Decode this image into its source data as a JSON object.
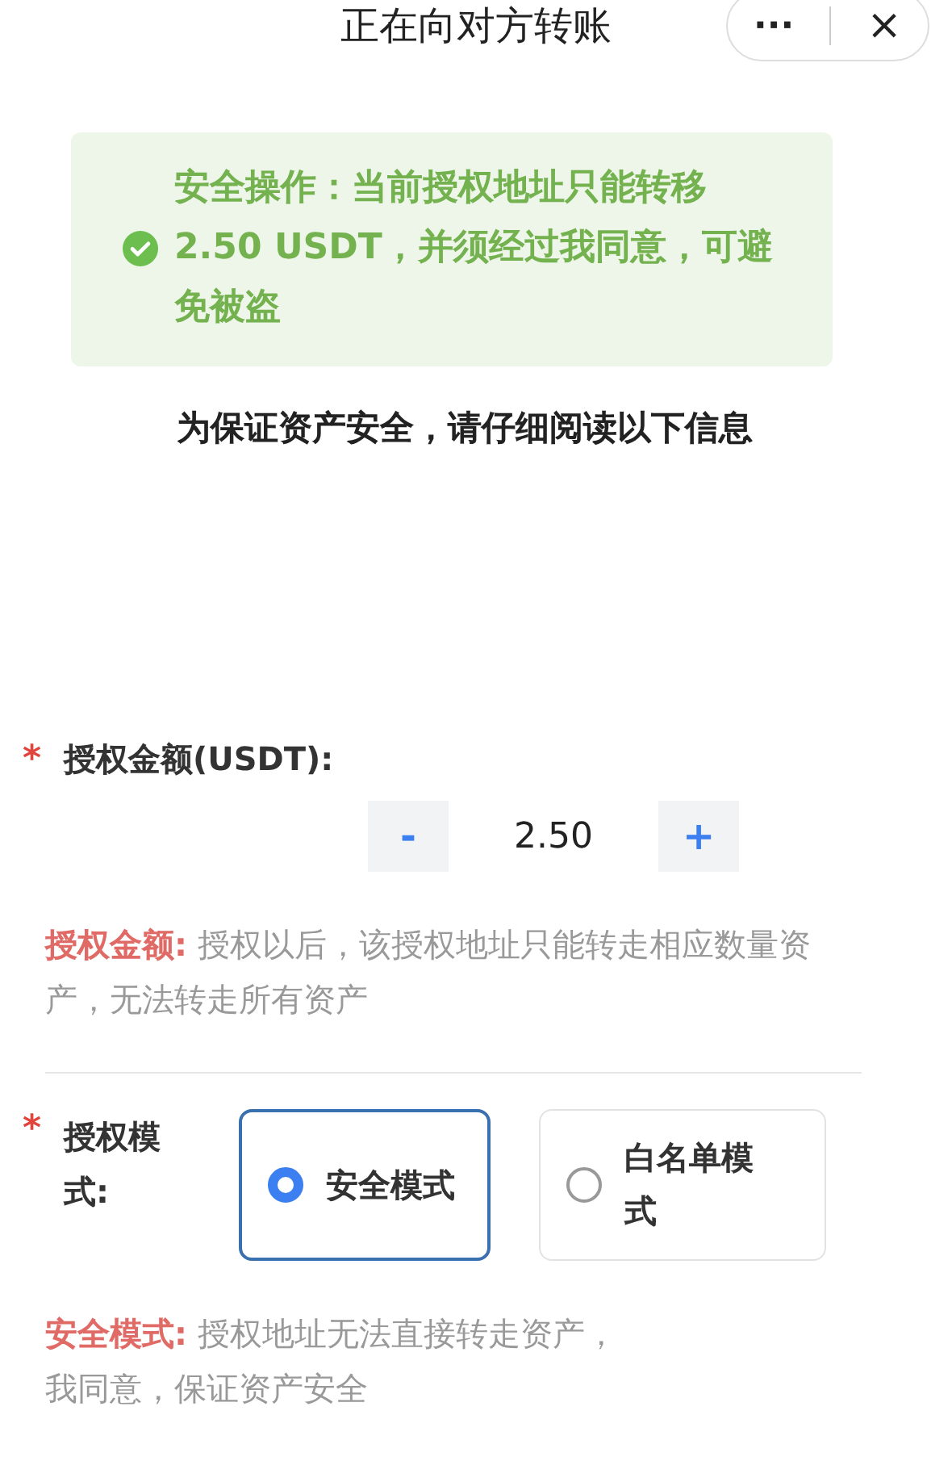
{
  "header": {
    "title": "正在向对方转账",
    "more": "···",
    "close": "×"
  },
  "notice": {
    "text": "安全操作：当前授权地址只能转移2.50 USDT，并须经过我同意，可避免被盗"
  },
  "heading": "为保证资产安全，请仔细阅读以下信息",
  "amount": {
    "required_mark": "*",
    "label": "授权金额(USDT):",
    "minus": "-",
    "value": "2.50",
    "plus": "+"
  },
  "amount_note": {
    "label": "授权金额:",
    "text": "授权以后，该授权地址只能转走相应数量资产，无法转走所有资产"
  },
  "mode": {
    "required_mark": "*",
    "label": "授权模式:",
    "options": [
      {
        "label": "安全模式",
        "selected": true
      },
      {
        "label": "白名单模式",
        "selected": false
      }
    ]
  },
  "mode_note": {
    "label": "安全模式:",
    "text": "授权地址无法直接转走资产，",
    "text_2": "我同意，保证资产安全"
  }
}
